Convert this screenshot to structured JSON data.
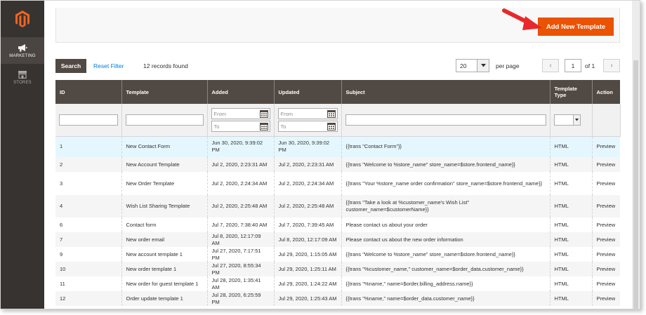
{
  "sidebar": {
    "items": [
      {
        "label": "MARKETING",
        "icon": "megaphone-icon"
      },
      {
        "label": "STORES",
        "icon": "store-icon"
      }
    ]
  },
  "header": {
    "add_button": "Add New Template"
  },
  "toolbar": {
    "search_label": "Search",
    "reset_label": "Reset Filter",
    "records_text": "12 records found",
    "per_page_value": "20",
    "per_page_label": "per page",
    "page_value": "1",
    "page_of": "of 1"
  },
  "grid": {
    "columns": [
      "ID",
      "Template",
      "Added",
      "Updated",
      "Subject",
      "Template Type",
      "Action"
    ],
    "filters": {
      "date_from_placeholder": "From",
      "date_to_placeholder": "To"
    },
    "rows": [
      {
        "id": "1",
        "template": "New Contact Form",
        "added": "Jun 30, 2020, 9:39:02 PM",
        "updated": "Jun 30, 2020, 9:39:02 PM",
        "subject": "{{trans \"Contact Form\"}}",
        "type": "HTML",
        "action": "Preview"
      },
      {
        "id": "2",
        "template": "New Account Template",
        "added": "Jul 2, 2020, 2:23:31 AM",
        "updated": "Jul 2, 2020, 2:23:31 AM",
        "subject": "{{trans \"Welcome to %store_name\" store_name=$store.frontend_name}}",
        "type": "HTML",
        "action": "Preview"
      },
      {
        "id": "3",
        "template": "New Order Template",
        "added": "Jul 2, 2020, 2:24:34 AM",
        "updated": "Jul 2, 2020, 2:24:34 AM",
        "subject": "{{trans \"Your %store_name order confirmation\" store_name=$store.frontend_name}}",
        "type": "HTML",
        "action": "Preview"
      },
      {
        "id": "4",
        "template": "Wish List Sharing Template",
        "added": "Jul 2, 2020, 2:25:48 AM",
        "updated": "Jul 2, 2020, 2:25:48 AM",
        "subject": "{{trans \"Take a look at %customer_name's Wish List\" customer_name=$customerName}}",
        "type": "HTML",
        "action": "Preview"
      },
      {
        "id": "6",
        "template": "Contact form",
        "added": "Jul 7, 2020, 7:38:40 AM",
        "updated": "Jul 7, 2020, 7:39:45 AM",
        "subject": "Please contact us about your order",
        "type": "HTML",
        "action": "Preview"
      },
      {
        "id": "7",
        "template": "New order email",
        "added": "Jul 8, 2020, 12:17:09 AM",
        "updated": "Jul 8, 2020, 12:17:09 AM",
        "subject": "Please contact us about the new order information",
        "type": "HTML",
        "action": "Preview"
      },
      {
        "id": "9",
        "template": "New account template 1",
        "added": "Jul 27, 2020, 7:17:51 PM",
        "updated": "Jul 29, 2020, 1:15:05 AM",
        "subject": "{{trans \"Welcome to %store_name\" store_name=$store.frontend_name}}",
        "type": "HTML",
        "action": "Preview"
      },
      {
        "id": "10",
        "template": "New order template 1",
        "added": "Jul 27, 2020, 8:55:34 PM",
        "updated": "Jul 29, 2020, 1:25:11 AM",
        "subject": "{{trans \"%customer_name,\" customer_name=$order_data.customer_name}}",
        "type": "HTML",
        "action": "Preview"
      },
      {
        "id": "11",
        "template": "New order for guest template 1",
        "added": "Jul 28, 2020, 1:35:41 AM",
        "updated": "Jul 29, 2020, 1:24:22 AM",
        "subject": "{{trans \"%name,\" name=$order.billing_address.name}}",
        "type": "HTML",
        "action": "Preview"
      },
      {
        "id": "12",
        "template": "Order update template 1",
        "added": "Jul 28, 2020, 6:25:59 PM",
        "updated": "Jul 29, 2020, 1:25:43 AM",
        "subject": "{{trans \"%name,\" name=$order_data.customer_name}}",
        "type": "HTML",
        "action": "Preview"
      }
    ]
  },
  "colors": {
    "accent": "#eb5202",
    "header_bg": "#514943",
    "sidebar_bg": "#373330",
    "link": "#007bdb",
    "highlight_row": "#e5f7fe"
  }
}
